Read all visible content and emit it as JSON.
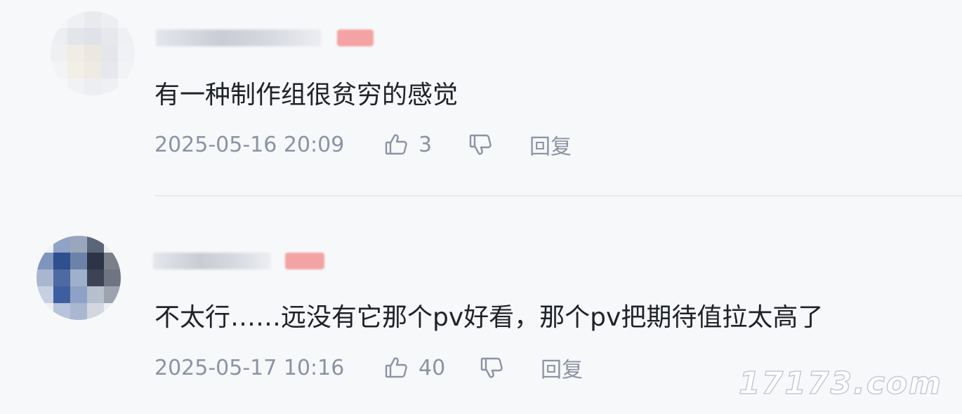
{
  "comments": [
    {
      "text": "有一种制作组很贫穷的感觉",
      "time": "2025-05-16 20:09",
      "likes": "3",
      "reply_label": "回复"
    },
    {
      "text": "不太行……远没有它那个pv好看，那个pv把期待值拉太高了",
      "time": "2025-05-17 10:16",
      "likes": "40",
      "reply_label": "回复"
    }
  ],
  "colors": {
    "background": "#f7f8fa",
    "meta_text": "#8c93a2",
    "badge": "#f3a3a3",
    "divider": "#e7e9ee"
  },
  "icons": {
    "like": "thumbs-up-icon",
    "dislike": "thumbs-down-icon"
  },
  "watermark": "17173.com"
}
